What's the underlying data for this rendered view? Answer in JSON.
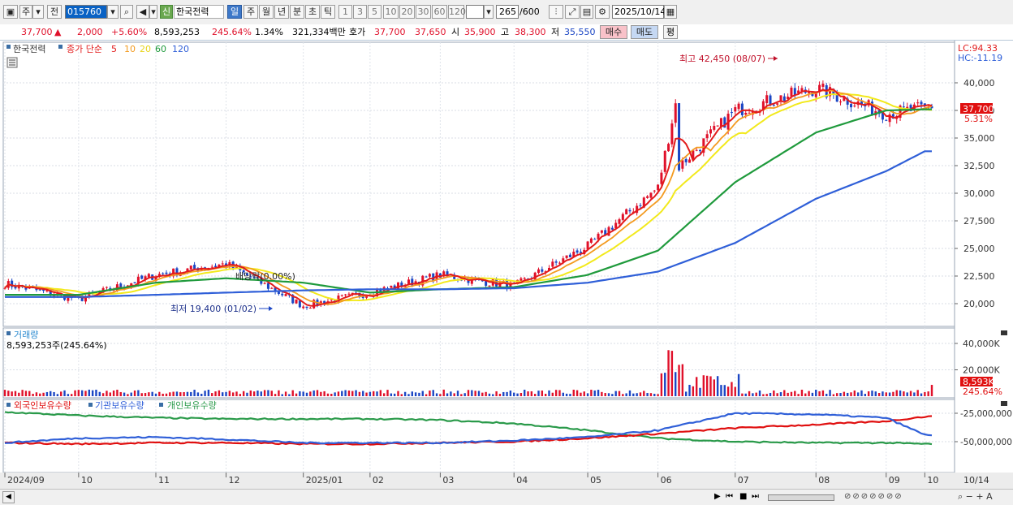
{
  "toolbar": {
    "btn_ju": "주",
    "btn_jeon": "전",
    "code_value": "015760",
    "stock_badge": "신",
    "stock_name": "한국전력",
    "periods": [
      "일",
      "주",
      "월",
      "년",
      "분",
      "초",
      "틱"
    ],
    "active_period": "일",
    "minute_options": [
      "1",
      "3",
      "5",
      "10",
      "20",
      "30",
      "60",
      "120"
    ],
    "count_value": "265",
    "count_max": "/600",
    "date_value": "2025/10/14"
  },
  "quote": {
    "price": "37,700",
    "change_arrow": "▲",
    "change": "2,000",
    "change_pct": "+5.60%",
    "volume": "8,593,253",
    "volume_ratio": "245.64%",
    "turnover": "1.34%",
    "amount": "321,334백만",
    "hoga_label": "호가",
    "ask": "37,700",
    "bid": "37,650",
    "open_label": "시",
    "open": "35,900",
    "high_label": "고",
    "high": "38,300",
    "low_label": "저",
    "low": "35,550",
    "buy_label": "매수",
    "sell_label": "매도",
    "eval_label": "평"
  },
  "price_panel": {
    "legend_name": "한국전력",
    "legend_title": "종가 단순",
    "ma_labels": [
      "5",
      "10",
      "20",
      "60",
      "120"
    ],
    "lc": "LC:94.33",
    "hc": "HC:-11.19",
    "current_price_label": "37,700",
    "current_pct_label": "5.31%",
    "y_ticks": [
      "40,000",
      "37,500",
      "35,000",
      "32,500",
      "30,000",
      "27,500",
      "25,000",
      "22,500",
      "20,000"
    ],
    "annotation_high": "최고 42,450 (08/07)",
    "annotation_low": "최저 19,400 (01/02)",
    "annotation_dividend": "배당락(0.00%)"
  },
  "volume_panel": {
    "title": "거래량",
    "value_text": "8,593,253주(245.64%)",
    "y_ticks": [
      "40,000K",
      "20,000K"
    ],
    "current_label": "8,593K",
    "current_pct": "245.64%"
  },
  "holding_panel": {
    "legend": [
      "외국인보유수량",
      "기관보유수량",
      "개인보유수량"
    ],
    "y_ticks": [
      "-25,000,000",
      "-50,000,000"
    ]
  },
  "x_axis": {
    "labels": [
      "2024/09",
      "10",
      "11",
      "12",
      "2025/01",
      "02",
      "03",
      "04",
      "05",
      "06",
      "07",
      "08",
      "09",
      "10"
    ],
    "right_label": "10/14"
  },
  "colors": {
    "ma5": "#e21b1b",
    "ma10": "#f39a1f",
    "ma20": "#f2e91c",
    "ma60": "#1f9a3c",
    "ma120": "#2f5fd8",
    "up": "#e0102a",
    "down": "#1b46c4",
    "foreign": "#e01010",
    "institution": "#2f5fd8",
    "individual": "#2a9a4a"
  },
  "chart_data": {
    "type": "line",
    "title": "한국전력 종가 단순",
    "x": [
      "2024/09",
      "10",
      "11",
      "12",
      "2025/01",
      "02",
      "03",
      "04",
      "05",
      "06",
      "07",
      "08",
      "09",
      "10"
    ],
    "series": [
      {
        "name": "종가",
        "values": [
          21800,
          20400,
          22600,
          23600,
          19800,
          21000,
          22600,
          21600,
          25200,
          30500,
          37500,
          39500,
          37200,
          37700
        ]
      },
      {
        "name": "60",
        "values": [
          20800,
          20800,
          21900,
          22300,
          21900,
          21000,
          21300,
          21500,
          22600,
          24800,
          31000,
          35500,
          37500,
          37600
        ]
      },
      {
        "name": "120",
        "values": [
          20600,
          20600,
          20800,
          21000,
          21200,
          21300,
          21300,
          21400,
          21900,
          22900,
          25500,
          29500,
          32000,
          33800
        ]
      }
    ],
    "ylim": [
      19000,
      42700
    ]
  }
}
